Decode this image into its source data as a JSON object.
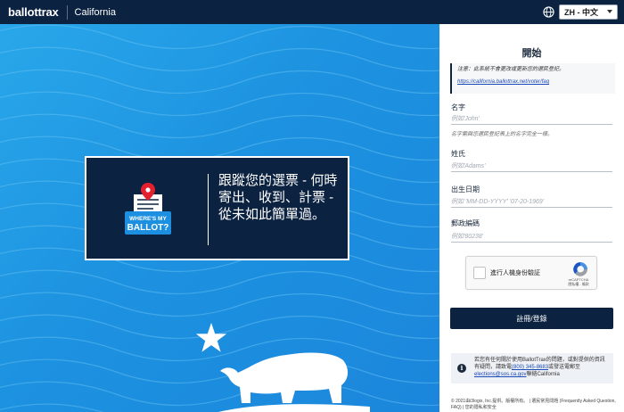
{
  "header": {
    "brand": "ballottrax",
    "state": "California",
    "globe_icon": "globe-icon",
    "language_selected": "ZH - 中文"
  },
  "hero": {
    "logo_text_line1": "WHERE'S MY",
    "logo_text_line2": "BALLOT?",
    "tagline": "跟蹤您的選票 - 何時寄出、收到、計票 - 從未如此簡單過。",
    "colors": {
      "background": "#1d92e0",
      "card": "#0b2240"
    }
  },
  "form": {
    "title": "開始",
    "notice": "注意：此系統不會更改或更新您的選民登記。",
    "notice_link": "https://california.ballottrax.net/voter/faq",
    "first_name": {
      "label": "名字",
      "placeholder": "例如'John'",
      "help": "名字需與您選民登記表上的名字完全一樣。"
    },
    "last_name": {
      "label": "姓氏",
      "placeholder": "例如'Adams'"
    },
    "dob": {
      "label": "出生日期",
      "placeholder": "例如 'MM-DD-YYYY' '07-20-1969'"
    },
    "zip": {
      "label": "郵政編碼",
      "placeholder": "例如'80238'"
    },
    "captcha": {
      "label": "進行人機身份驗証",
      "brand": "reCAPTCHA",
      "links": "隱私權 - 條款"
    },
    "submit_label": "註冊/登錄",
    "help": {
      "text_before_phone": "若您有任何關於使用BallotTrax的問題，或對提供的資訊有疑問，請致電",
      "phone": "(800) 345-8683",
      "text_between": "或發送電郵至",
      "email": "elections@sos.ca.gov",
      "text_after": "聯絡California"
    },
    "footer": "© 2021由i3logix, Inc.提供。版權所有。 | 選民常見問題 (Frequently Asked Question, FAQ) | 您的隱私和安全"
  }
}
